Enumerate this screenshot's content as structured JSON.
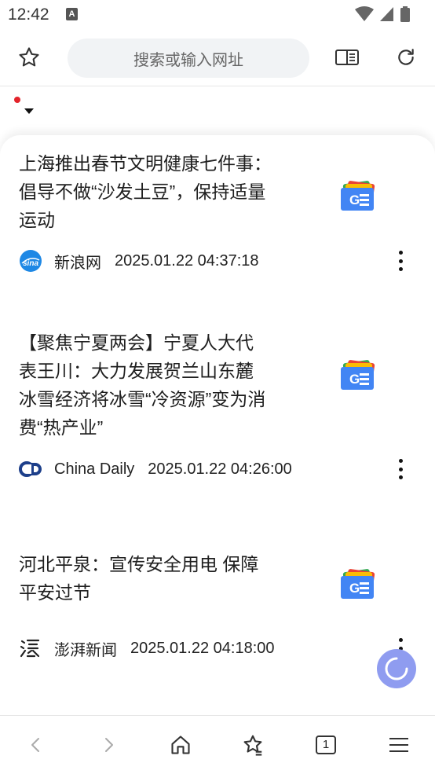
{
  "status_bar": {
    "time": "12:42",
    "notification_glyph": "A",
    "icons": [
      "notification-icon",
      "wifi-icon",
      "signal-icon",
      "battery-icon"
    ]
  },
  "toolbar": {
    "search_placeholder": "搜索或输入网址",
    "icons": [
      "bookmark-star-icon",
      "reader-mode-icon",
      "refresh-icon"
    ]
  },
  "articles": [
    {
      "title_lines": [
        "上海推出春节文明健康七件事：",
        "倡导不做“沙发土豆”，保持适量",
        "运动"
      ],
      "source": "新浪网",
      "time": "2025.01.22 04:37:18",
      "source_icon": "sina-logo-icon"
    },
    {
      "title_lines": [
        "【聚焦宁夏两会】宁夏人大代",
        "表王川：大力发展贺兰山东麓",
        "冰雪经济将冰雪“冷资源”变为消",
        "费“热产业”"
      ],
      "source": "China Daily",
      "time": "2025.01.22 04:26:00",
      "source_icon": "china-daily-logo-icon"
    },
    {
      "title_lines": [
        "河北平泉：宣传安全用电 保障",
        "平安过节"
      ],
      "source": "澎湃新闻",
      "time": "2025.01.22 04:18:00",
      "source_icon": "thepaper-logo-icon"
    }
  ],
  "bottom_bar": {
    "tab_count": "1",
    "icons": [
      "back-icon",
      "forward-icon",
      "home-icon",
      "bookmarks-icon",
      "tabs-icon",
      "menu-icon"
    ]
  },
  "colors": {
    "accent_red": "#e3242b",
    "loader": "#8f9cf0",
    "search_bg": "#f1f3f5"
  }
}
